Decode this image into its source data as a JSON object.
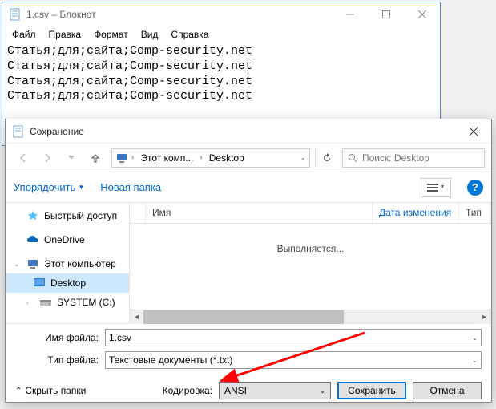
{
  "notepad": {
    "title": "1.csv – Блокнот",
    "menu": {
      "file": "Файл",
      "edit": "Правка",
      "format": "Формат",
      "view": "Вид",
      "help": "Справка"
    },
    "content": "Статья;для;сайта;Comp-security.net\nСтатья;для;сайта;Comp-security.net\nСтатья;для;сайта;Comp-security.net\nСтатья;для;сайта;Comp-security.net"
  },
  "dialog": {
    "title": "Сохранение",
    "breadcrumb": {
      "pc": "Этот комп...",
      "folder": "Desktop"
    },
    "search_placeholder": "Поиск: Desktop",
    "organize": "Упорядочить",
    "newfolder": "Новая папка",
    "columns": {
      "name": "Имя",
      "date": "Дата изменения",
      "type": "Тип"
    },
    "loading": "Выполняется...",
    "sidebar": {
      "quick": "Быстрый доступ",
      "onedrive": "OneDrive",
      "thispc": "Этот компьютер",
      "desktop": "Desktop",
      "system": "SYSTEM (C:)"
    },
    "filename_label": "Имя файла:",
    "filename_value": "1.csv",
    "filetype_label": "Тип файла:",
    "filetype_value": "Текстовые документы (*.txt)",
    "hide_folders": "Скрыть папки",
    "encoding_label": "Кодировка:",
    "encoding_value": "ANSI",
    "save": "Сохранить",
    "cancel": "Отмена"
  }
}
